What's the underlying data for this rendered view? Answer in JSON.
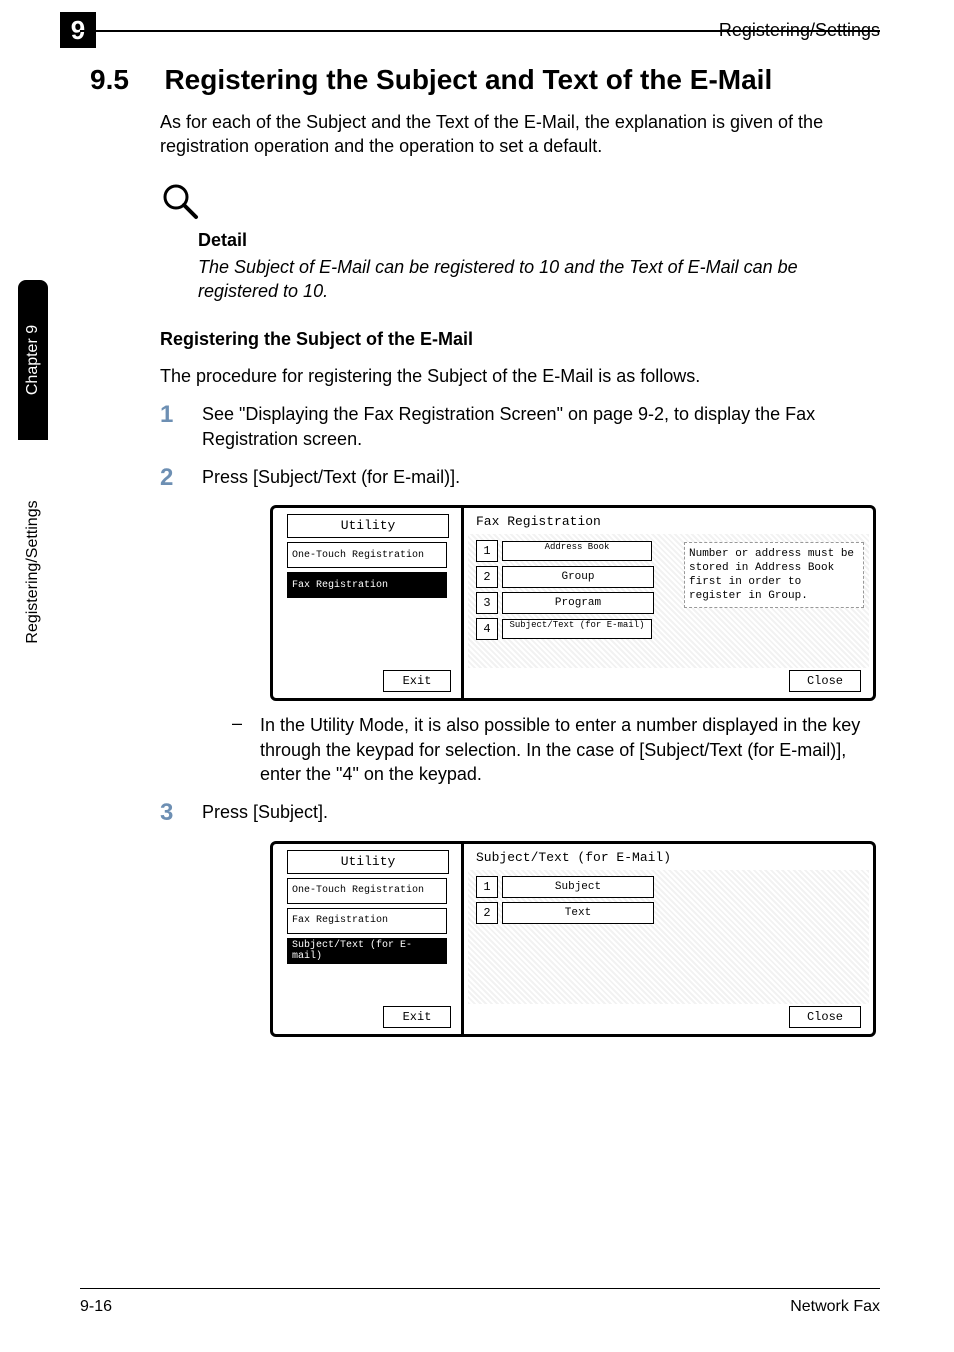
{
  "header": {
    "chapter_badge": "9",
    "running_head": "Registering/Settings"
  },
  "side_tabs": {
    "chapter": "Chapter 9",
    "section": "Registering/Settings"
  },
  "section": {
    "number": "9.5",
    "title": "Registering the Subject and Text of the E-Mail",
    "intro": "As for each of the Subject and the Text of the E-Mail, the explanation is given of the registration operation and the operation to set a default."
  },
  "detail": {
    "label": "Detail",
    "text": "The Subject of E-Mail can be registered to 10 and the Text of E-Mail can be registered to 10."
  },
  "subhead": "Registering the Subject of the E-Mail",
  "lead_in": "The procedure for registering the Subject of the E-Mail is as follows.",
  "steps": {
    "s1": {
      "num": "1",
      "text": "See \"Displaying the Fax Registration Screen\" on page 9-2, to display the Fax Registration screen."
    },
    "s2": {
      "num": "2",
      "text": "Press [Subject/Text (for E-mail)]."
    },
    "s3": {
      "num": "3",
      "text": "Press [Subject]."
    }
  },
  "bullet_after_panel1": "In the Utility Mode, it is also possible to enter a number displayed in the key through the keypad for selection. In the case of [Subject/Text (for E-mail)], enter the \"4\" on the keypad.",
  "panel1": {
    "left_tabs": {
      "utility": "Utility",
      "onetouch": "One-Touch Registration",
      "faxreg": "Fax Registration"
    },
    "exit": "Exit",
    "title": "Fax Registration",
    "options": {
      "o1": {
        "n": "1",
        "label": "Address Book"
      },
      "o2": {
        "n": "2",
        "label": "Group"
      },
      "o3": {
        "n": "3",
        "label": "Program"
      },
      "o4": {
        "n": "4",
        "label": "Subject/Text (for E-mail)"
      }
    },
    "info": "Number or address must be stored in Address Book first in order to register in Group.",
    "close": "Close"
  },
  "panel2": {
    "left_tabs": {
      "utility": "Utility",
      "onetouch": "One-Touch Registration",
      "faxreg": "Fax Registration",
      "subjtext": "Subject/Text (for E-mail)"
    },
    "exit": "Exit",
    "title": "Subject/Text (for E-Mail)",
    "options": {
      "o1": {
        "n": "1",
        "label": "Subject"
      },
      "o2": {
        "n": "2",
        "label": "Text"
      }
    },
    "close": "Close"
  },
  "footer": {
    "left": "9-16",
    "right": "Network Fax"
  }
}
